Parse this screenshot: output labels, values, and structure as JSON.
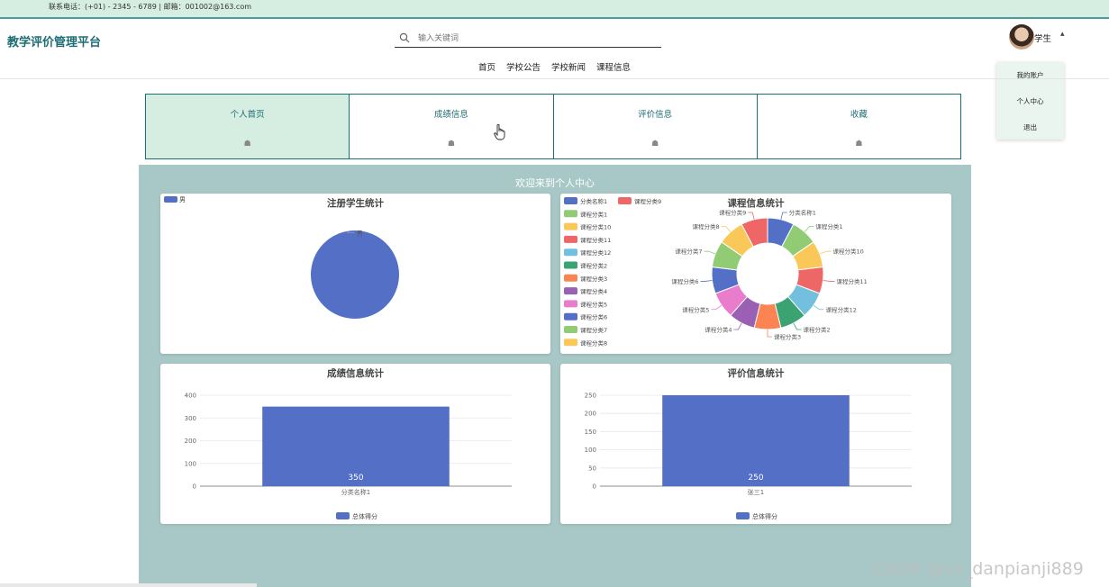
{
  "topbar": {
    "contact": "联系电话：(+01) - 2345 - 6789 | 邮箱：001002@163.com"
  },
  "header": {
    "logo": "教学评价管理平台",
    "search_placeholder": "输入关键词",
    "nav": [
      "首页",
      "学校公告",
      "学校新闻",
      "课程信息"
    ],
    "user": {
      "name": "学生"
    },
    "user_menu": [
      "我的账户",
      "个人中心",
      "退出"
    ]
  },
  "tabs": [
    {
      "label": "个人首页",
      "active": true
    },
    {
      "label": "成绩信息",
      "active": false
    },
    {
      "label": "评价信息",
      "active": false
    },
    {
      "label": "收藏",
      "active": false
    }
  ],
  "tab_icon_glyph": "☗",
  "welcome": "欢迎来到个人中心",
  "colors": {
    "accent": "#1d6d74",
    "panel": "#a7c8c6",
    "bar": "#5470c6",
    "palette": [
      "#5470c6",
      "#91cc75",
      "#fac858",
      "#ee6666",
      "#73c0de",
      "#3ba272",
      "#fc8452",
      "#9a60b4",
      "#ea7ccc",
      "#5470c6",
      "#91cc75",
      "#fac858",
      "#ee6666"
    ]
  },
  "chart_data": [
    {
      "type": "pie",
      "title": "注册学生统计",
      "labels": [
        "男"
      ],
      "values": [
        1
      ],
      "legend": "top-left"
    },
    {
      "type": "pie",
      "variant": "donut",
      "title": "课程信息统计",
      "labels": [
        "分类名称1",
        "课程分类1",
        "课程分类10",
        "课程分类11",
        "课程分类12",
        "课程分类2",
        "课程分类3",
        "课程分类4",
        "课程分类5",
        "课程分类6",
        "课程分类7",
        "课程分类8",
        "课程分类9"
      ],
      "values": [
        1,
        1,
        1,
        1,
        1,
        1,
        1,
        1,
        1,
        1,
        1,
        1,
        1
      ],
      "legend": "left"
    },
    {
      "type": "bar",
      "title": "成绩信息统计",
      "categories": [
        "分类名称1"
      ],
      "series": [
        {
          "name": "总体得分",
          "values": [
            350
          ]
        }
      ],
      "ylim": [
        0,
        400
      ],
      "yticks": [
        0,
        100,
        200,
        300,
        400
      ],
      "legend": "bottom"
    },
    {
      "type": "bar",
      "title": "评价信息统计",
      "categories": [
        "张三1"
      ],
      "series": [
        {
          "name": "总体得分",
          "values": [
            250
          ]
        }
      ],
      "ylim": [
        0,
        250
      ],
      "yticks": [
        0,
        50,
        100,
        150,
        200,
        250
      ],
      "legend": "bottom"
    }
  ],
  "watermark": "CSDN @vx_danpianji889"
}
